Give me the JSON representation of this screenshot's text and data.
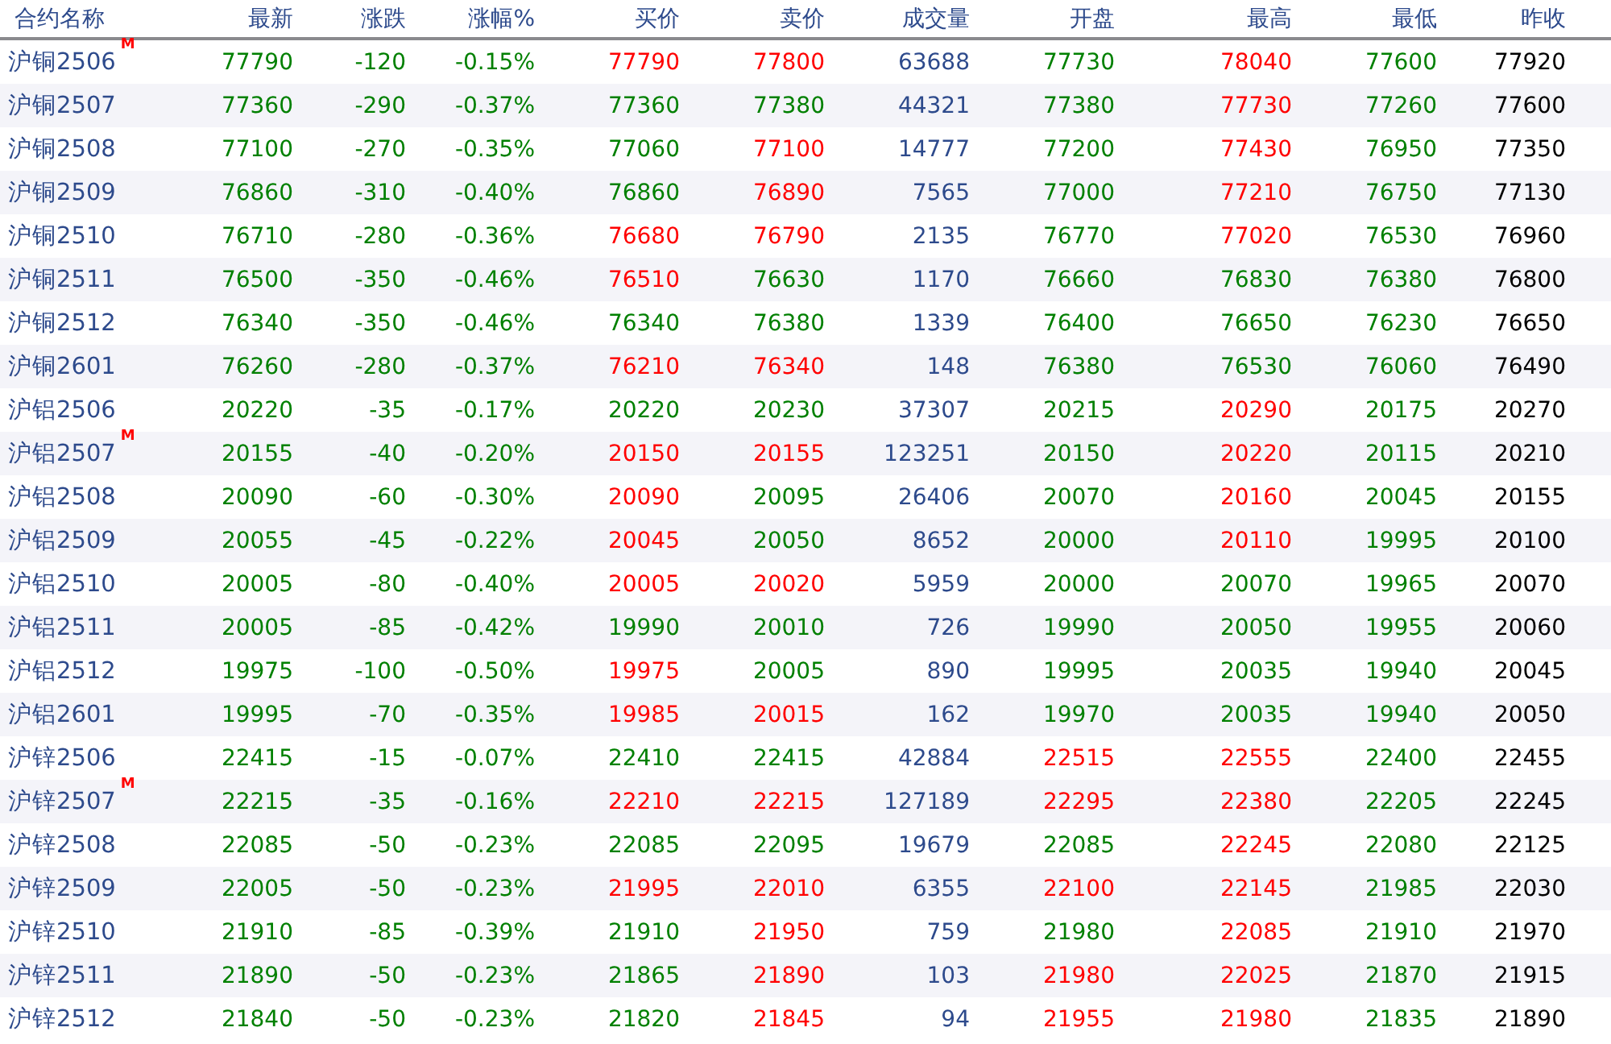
{
  "columns": [
    {
      "label": "合约名称",
      "kind": "name"
    },
    {
      "label": "最新",
      "kind": "price"
    },
    {
      "label": "涨跌",
      "kind": "price"
    },
    {
      "label": "涨幅%",
      "kind": "price"
    },
    {
      "label": "买价",
      "kind": "price"
    },
    {
      "label": "卖价",
      "kind": "price"
    },
    {
      "label": "成交量",
      "kind": "volume"
    },
    {
      "label": "开盘",
      "kind": "price"
    },
    {
      "label": "最高",
      "kind": "price"
    },
    {
      "label": "最低",
      "kind": "price"
    },
    {
      "label": "昨收",
      "kind": "close"
    }
  ],
  "rows": [
    {
      "name": "沪铜2506",
      "flag": "M",
      "cells": [
        {
          "text": "77790",
          "color": "#008000"
        },
        {
          "text": "-120",
          "color": "#008000"
        },
        {
          "text": "-0.15%",
          "color": "#008000"
        },
        {
          "text": "77790",
          "color": "#ff0000"
        },
        {
          "text": "77800",
          "color": "#ff0000"
        },
        {
          "text": "63688"
        },
        {
          "text": "77730",
          "color": "#008000"
        },
        {
          "text": "78040",
          "color": "#ff0000"
        },
        {
          "text": "77600",
          "color": "#008000"
        },
        {
          "text": "77920"
        }
      ]
    },
    {
      "name": "沪铜2507",
      "cells": [
        {
          "text": "77360",
          "color": "#008000"
        },
        {
          "text": "-290",
          "color": "#008000"
        },
        {
          "text": "-0.37%",
          "color": "#008000"
        },
        {
          "text": "77360",
          "color": "#008000"
        },
        {
          "text": "77380",
          "color": "#008000"
        },
        {
          "text": "44321"
        },
        {
          "text": "77380",
          "color": "#008000"
        },
        {
          "text": "77730",
          "color": "#ff0000"
        },
        {
          "text": "77260",
          "color": "#008000"
        },
        {
          "text": "77600"
        }
      ]
    },
    {
      "name": "沪铜2508",
      "cells": [
        {
          "text": "77100",
          "color": "#008000"
        },
        {
          "text": "-270",
          "color": "#008000"
        },
        {
          "text": "-0.35%",
          "color": "#008000"
        },
        {
          "text": "77060",
          "color": "#008000"
        },
        {
          "text": "77100",
          "color": "#ff0000"
        },
        {
          "text": "14777"
        },
        {
          "text": "77200",
          "color": "#008000"
        },
        {
          "text": "77430",
          "color": "#ff0000"
        },
        {
          "text": "76950",
          "color": "#008000"
        },
        {
          "text": "77350"
        }
      ]
    },
    {
      "name": "沪铜2509",
      "cells": [
        {
          "text": "76860",
          "color": "#008000"
        },
        {
          "text": "-310",
          "color": "#008000"
        },
        {
          "text": "-0.40%",
          "color": "#008000"
        },
        {
          "text": "76860",
          "color": "#008000"
        },
        {
          "text": "76890",
          "color": "#ff0000"
        },
        {
          "text": "7565"
        },
        {
          "text": "77000",
          "color": "#008000"
        },
        {
          "text": "77210",
          "color": "#ff0000"
        },
        {
          "text": "76750",
          "color": "#008000"
        },
        {
          "text": "77130"
        }
      ]
    },
    {
      "name": "沪铜2510",
      "cells": [
        {
          "text": "76710",
          "color": "#008000"
        },
        {
          "text": "-280",
          "color": "#008000"
        },
        {
          "text": "-0.36%",
          "color": "#008000"
        },
        {
          "text": "76680",
          "color": "#ff0000"
        },
        {
          "text": "76790",
          "color": "#ff0000"
        },
        {
          "text": "2135"
        },
        {
          "text": "76770",
          "color": "#008000"
        },
        {
          "text": "77020",
          "color": "#ff0000"
        },
        {
          "text": "76530",
          "color": "#008000"
        },
        {
          "text": "76960"
        }
      ]
    },
    {
      "name": "沪铜2511",
      "cells": [
        {
          "text": "76500",
          "color": "#008000"
        },
        {
          "text": "-350",
          "color": "#008000"
        },
        {
          "text": "-0.46%",
          "color": "#008000"
        },
        {
          "text": "76510",
          "color": "#ff0000"
        },
        {
          "text": "76630",
          "color": "#008000"
        },
        {
          "text": "1170"
        },
        {
          "text": "76660",
          "color": "#008000"
        },
        {
          "text": "76830",
          "color": "#008000"
        },
        {
          "text": "76380",
          "color": "#008000"
        },
        {
          "text": "76800"
        }
      ]
    },
    {
      "name": "沪铜2512",
      "cells": [
        {
          "text": "76340",
          "color": "#008000"
        },
        {
          "text": "-350",
          "color": "#008000"
        },
        {
          "text": "-0.46%",
          "color": "#008000"
        },
        {
          "text": "76340",
          "color": "#008000"
        },
        {
          "text": "76380",
          "color": "#008000"
        },
        {
          "text": "1339"
        },
        {
          "text": "76400",
          "color": "#008000"
        },
        {
          "text": "76650",
          "color": "#008000"
        },
        {
          "text": "76230",
          "color": "#008000"
        },
        {
          "text": "76650"
        }
      ]
    },
    {
      "name": "沪铜2601",
      "cells": [
        {
          "text": "76260",
          "color": "#008000"
        },
        {
          "text": "-280",
          "color": "#008000"
        },
        {
          "text": "-0.37%",
          "color": "#008000"
        },
        {
          "text": "76210",
          "color": "#ff0000"
        },
        {
          "text": "76340",
          "color": "#ff0000"
        },
        {
          "text": "148"
        },
        {
          "text": "76380",
          "color": "#008000"
        },
        {
          "text": "76530",
          "color": "#008000"
        },
        {
          "text": "76060",
          "color": "#008000"
        },
        {
          "text": "76490"
        }
      ]
    },
    {
      "name": "沪铝2506",
      "cells": [
        {
          "text": "20220",
          "color": "#008000"
        },
        {
          "text": "-35",
          "color": "#008000"
        },
        {
          "text": "-0.17%",
          "color": "#008000"
        },
        {
          "text": "20220",
          "color": "#008000"
        },
        {
          "text": "20230",
          "color": "#008000"
        },
        {
          "text": "37307"
        },
        {
          "text": "20215",
          "color": "#008000"
        },
        {
          "text": "20290",
          "color": "#ff0000"
        },
        {
          "text": "20175",
          "color": "#008000"
        },
        {
          "text": "20270"
        }
      ]
    },
    {
      "name": "沪铝2507",
      "flag": "M",
      "cells": [
        {
          "text": "20155",
          "color": "#008000"
        },
        {
          "text": "-40",
          "color": "#008000"
        },
        {
          "text": "-0.20%",
          "color": "#008000"
        },
        {
          "text": "20150",
          "color": "#ff0000"
        },
        {
          "text": "20155",
          "color": "#ff0000"
        },
        {
          "text": "123251"
        },
        {
          "text": "20150",
          "color": "#008000"
        },
        {
          "text": "20220",
          "color": "#ff0000"
        },
        {
          "text": "20115",
          "color": "#008000"
        },
        {
          "text": "20210"
        }
      ]
    },
    {
      "name": "沪铝2508",
      "cells": [
        {
          "text": "20090",
          "color": "#008000"
        },
        {
          "text": "-60",
          "color": "#008000"
        },
        {
          "text": "-0.30%",
          "color": "#008000"
        },
        {
          "text": "20090",
          "color": "#ff0000"
        },
        {
          "text": "20095",
          "color": "#008000"
        },
        {
          "text": "26406"
        },
        {
          "text": "20070",
          "color": "#008000"
        },
        {
          "text": "20160",
          "color": "#ff0000"
        },
        {
          "text": "20045",
          "color": "#008000"
        },
        {
          "text": "20155"
        }
      ]
    },
    {
      "name": "沪铝2509",
      "cells": [
        {
          "text": "20055",
          "color": "#008000"
        },
        {
          "text": "-45",
          "color": "#008000"
        },
        {
          "text": "-0.22%",
          "color": "#008000"
        },
        {
          "text": "20045",
          "color": "#ff0000"
        },
        {
          "text": "20050",
          "color": "#008000"
        },
        {
          "text": "8652"
        },
        {
          "text": "20000",
          "color": "#008000"
        },
        {
          "text": "20110",
          "color": "#ff0000"
        },
        {
          "text": "19995",
          "color": "#008000"
        },
        {
          "text": "20100"
        }
      ]
    },
    {
      "name": "沪铝2510",
      "cells": [
        {
          "text": "20005",
          "color": "#008000"
        },
        {
          "text": "-80",
          "color": "#008000"
        },
        {
          "text": "-0.40%",
          "color": "#008000"
        },
        {
          "text": "20005",
          "color": "#ff0000"
        },
        {
          "text": "20020",
          "color": "#ff0000"
        },
        {
          "text": "5959"
        },
        {
          "text": "20000",
          "color": "#008000"
        },
        {
          "text": "20070",
          "color": "#008000"
        },
        {
          "text": "19965",
          "color": "#008000"
        },
        {
          "text": "20070"
        }
      ]
    },
    {
      "name": "沪铝2511",
      "cells": [
        {
          "text": "20005",
          "color": "#008000"
        },
        {
          "text": "-85",
          "color": "#008000"
        },
        {
          "text": "-0.42%",
          "color": "#008000"
        },
        {
          "text": "19990",
          "color": "#008000"
        },
        {
          "text": "20010",
          "color": "#008000"
        },
        {
          "text": "726"
        },
        {
          "text": "19990",
          "color": "#008000"
        },
        {
          "text": "20050",
          "color": "#008000"
        },
        {
          "text": "19955",
          "color": "#008000"
        },
        {
          "text": "20060"
        }
      ]
    },
    {
      "name": "沪铝2512",
      "cells": [
        {
          "text": "19975",
          "color": "#008000"
        },
        {
          "text": "-100",
          "color": "#008000"
        },
        {
          "text": "-0.50%",
          "color": "#008000"
        },
        {
          "text": "19975",
          "color": "#ff0000"
        },
        {
          "text": "20005",
          "color": "#008000"
        },
        {
          "text": "890"
        },
        {
          "text": "19995",
          "color": "#008000"
        },
        {
          "text": "20035",
          "color": "#008000"
        },
        {
          "text": "19940",
          "color": "#008000"
        },
        {
          "text": "20045"
        }
      ]
    },
    {
      "name": "沪铝2601",
      "cells": [
        {
          "text": "19995",
          "color": "#008000"
        },
        {
          "text": "-70",
          "color": "#008000"
        },
        {
          "text": "-0.35%",
          "color": "#008000"
        },
        {
          "text": "19985",
          "color": "#ff0000"
        },
        {
          "text": "20015",
          "color": "#ff0000"
        },
        {
          "text": "162"
        },
        {
          "text": "19970",
          "color": "#008000"
        },
        {
          "text": "20035",
          "color": "#008000"
        },
        {
          "text": "19940",
          "color": "#008000"
        },
        {
          "text": "20050"
        }
      ]
    },
    {
      "name": "沪锌2506",
      "cells": [
        {
          "text": "22415",
          "color": "#008000"
        },
        {
          "text": "-15",
          "color": "#008000"
        },
        {
          "text": "-0.07%",
          "color": "#008000"
        },
        {
          "text": "22410",
          "color": "#008000"
        },
        {
          "text": "22415",
          "color": "#008000"
        },
        {
          "text": "42884"
        },
        {
          "text": "22515",
          "color": "#ff0000"
        },
        {
          "text": "22555",
          "color": "#ff0000"
        },
        {
          "text": "22400",
          "color": "#008000"
        },
        {
          "text": "22455"
        }
      ]
    },
    {
      "name": "沪锌2507",
      "flag": "M",
      "cells": [
        {
          "text": "22215",
          "color": "#008000"
        },
        {
          "text": "-35",
          "color": "#008000"
        },
        {
          "text": "-0.16%",
          "color": "#008000"
        },
        {
          "text": "22210",
          "color": "#ff0000"
        },
        {
          "text": "22215",
          "color": "#ff0000"
        },
        {
          "text": "127189"
        },
        {
          "text": "22295",
          "color": "#ff0000"
        },
        {
          "text": "22380",
          "color": "#ff0000"
        },
        {
          "text": "22205",
          "color": "#008000"
        },
        {
          "text": "22245"
        }
      ]
    },
    {
      "name": "沪锌2508",
      "cells": [
        {
          "text": "22085",
          "color": "#008000"
        },
        {
          "text": "-50",
          "color": "#008000"
        },
        {
          "text": "-0.23%",
          "color": "#008000"
        },
        {
          "text": "22085",
          "color": "#008000"
        },
        {
          "text": "22095",
          "color": "#008000"
        },
        {
          "text": "19679"
        },
        {
          "text": "22085",
          "color": "#008000"
        },
        {
          "text": "22245",
          "color": "#ff0000"
        },
        {
          "text": "22080",
          "color": "#008000"
        },
        {
          "text": "22125"
        }
      ]
    },
    {
      "name": "沪锌2509",
      "cells": [
        {
          "text": "22005",
          "color": "#008000"
        },
        {
          "text": "-50",
          "color": "#008000"
        },
        {
          "text": "-0.23%",
          "color": "#008000"
        },
        {
          "text": "21995",
          "color": "#ff0000"
        },
        {
          "text": "22010",
          "color": "#ff0000"
        },
        {
          "text": "6355"
        },
        {
          "text": "22100",
          "color": "#ff0000"
        },
        {
          "text": "22145",
          "color": "#ff0000"
        },
        {
          "text": "21985",
          "color": "#008000"
        },
        {
          "text": "22030"
        }
      ]
    },
    {
      "name": "沪锌2510",
      "cells": [
        {
          "text": "21910",
          "color": "#008000"
        },
        {
          "text": "-85",
          "color": "#008000"
        },
        {
          "text": "-0.39%",
          "color": "#008000"
        },
        {
          "text": "21910",
          "color": "#008000"
        },
        {
          "text": "21950",
          "color": "#ff0000"
        },
        {
          "text": "759"
        },
        {
          "text": "21980",
          "color": "#008000"
        },
        {
          "text": "22085",
          "color": "#ff0000"
        },
        {
          "text": "21910",
          "color": "#008000"
        },
        {
          "text": "21970"
        }
      ]
    },
    {
      "name": "沪锌2511",
      "cells": [
        {
          "text": "21890",
          "color": "#008000"
        },
        {
          "text": "-50",
          "color": "#008000"
        },
        {
          "text": "-0.23%",
          "color": "#008000"
        },
        {
          "text": "21865",
          "color": "#008000"
        },
        {
          "text": "21890",
          "color": "#ff0000"
        },
        {
          "text": "103"
        },
        {
          "text": "21980",
          "color": "#ff0000"
        },
        {
          "text": "22025",
          "color": "#ff0000"
        },
        {
          "text": "21870",
          "color": "#008000"
        },
        {
          "text": "21915"
        }
      ]
    },
    {
      "name": "沪锌2512",
      "cells": [
        {
          "text": "21840",
          "color": "#008000"
        },
        {
          "text": "-50",
          "color": "#008000"
        },
        {
          "text": "-0.23%",
          "color": "#008000"
        },
        {
          "text": "21820",
          "color": "#008000"
        },
        {
          "text": "21845",
          "color": "#ff0000"
        },
        {
          "text": "94"
        },
        {
          "text": "21955",
          "color": "#ff0000"
        },
        {
          "text": "21980",
          "color": "#ff0000"
        },
        {
          "text": "21835",
          "color": "#008000"
        },
        {
          "text": "21890"
        }
      ]
    }
  ]
}
